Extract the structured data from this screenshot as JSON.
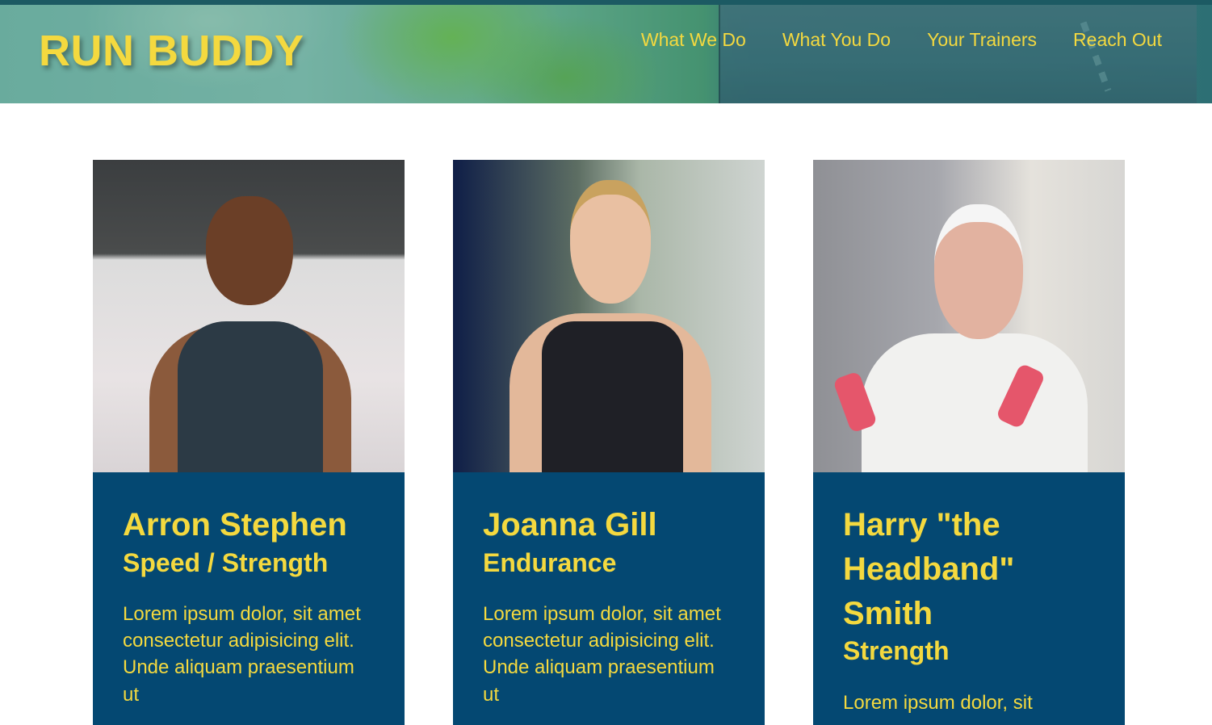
{
  "header": {
    "logo": "RUN BUDDY",
    "nav": [
      {
        "label": "What We Do"
      },
      {
        "label": "What You Do"
      },
      {
        "label": "Your Trainers"
      },
      {
        "label": "Reach Out"
      }
    ]
  },
  "trainers": [
    {
      "name": "Arron Stephen",
      "specialty": "Speed / Strength",
      "bio": "Lorem ipsum dolor, sit amet consectetur adipisicing elit. Unde aliquam praesentium ut"
    },
    {
      "name": "Joanna Gill",
      "specialty": "Endurance",
      "bio": "Lorem ipsum dolor, sit amet consectetur adipisicing elit. Unde aliquam praesentium ut"
    },
    {
      "name": "Harry \"the Headband\" Smith",
      "specialty": "Strength",
      "bio": "Lorem ipsum dolor, sit"
    }
  ],
  "colors": {
    "accent": "#f4d93f",
    "card_background": "#044872",
    "header_border": "#1c5a63"
  }
}
